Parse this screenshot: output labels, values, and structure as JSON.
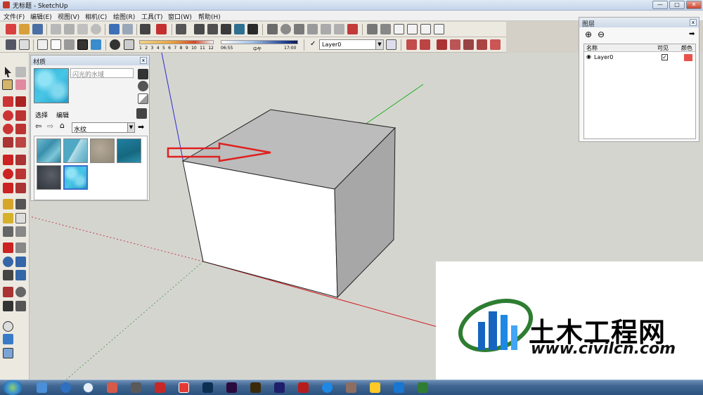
{
  "window": {
    "title": "无标题 - SketchUp",
    "btn_min": "—",
    "btn_max": "□",
    "btn_close": "✕"
  },
  "menu": {
    "items": [
      "文件(F)",
      "编辑(E)",
      "视图(V)",
      "相机(C)",
      "绘图(R)",
      "工具(T)",
      "窗口(W)",
      "帮助(H)"
    ]
  },
  "shadow": {
    "months": [
      "1",
      "2",
      "3",
      "4",
      "5",
      "6",
      "7",
      "8",
      "9",
      "10",
      "11",
      "12"
    ],
    "time_start": "06:55",
    "time_mid": "中午",
    "time_end": "17:00"
  },
  "layer_toolbar": {
    "current_layer": "Layer0",
    "check": "✓"
  },
  "materials_panel": {
    "title": "材质",
    "material_name": "闪光的水域",
    "tabs": [
      "选择",
      "编辑"
    ],
    "category": "水纹",
    "swatch_icons": [
      "water-ripple-swatch",
      "water-light-swatch",
      "stone-swatch",
      "deep-water-swatch",
      "dark-water-swatch",
      "shimmering-water-swatch"
    ],
    "selected_swatch_index": 5
  },
  "layers_panel": {
    "title": "图层",
    "columns": [
      "名称",
      "可见",
      "颜色"
    ],
    "rows": [
      {
        "name": "Layer0",
        "visible": true,
        "color": "#e8524a"
      }
    ]
  },
  "watermark": {
    "brand_cn": "土木工程网",
    "url": "www.civilcn.com"
  },
  "colors": {
    "accent_red": "#e02020",
    "water": "#2ab0d8",
    "layer0": "#e8524a"
  }
}
